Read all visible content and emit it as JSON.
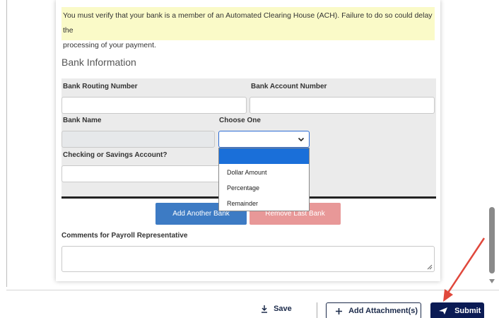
{
  "notice": {
    "line1": "You must verify that your bank is a member of an Automated Clearing House (ACH). Failure to do so could delay the",
    "line2": "processing of your payment."
  },
  "bank_section": {
    "title": "Bank Information",
    "routing_label": "Bank Routing Number",
    "account_label": "Bank Account Number",
    "bank_name_label": "Bank Name",
    "choose_label": "Choose One",
    "checking_label": "Checking or Savings Account?",
    "routing_value": "",
    "account_value": "",
    "bank_name_value": "",
    "checking_value": ""
  },
  "choose_select": {
    "selected": "",
    "options": [
      "",
      "Dollar Amount",
      "Percentage",
      "Remainder"
    ]
  },
  "buttons": {
    "add_bank": "Add Another Bank",
    "remove_bank": "Remove Last Bank"
  },
  "comments": {
    "label": "Comments for Payroll Representative",
    "value": ""
  },
  "footer": {
    "save": "Save",
    "attach": "Add Attachment(s)",
    "submit": "Submit"
  },
  "colors": {
    "accent_blue": "#3d7bc4",
    "remove_red": "#e89898",
    "submit_navy": "#0b1b54",
    "arrow_red": "#e0483c",
    "notice_yellow": "#fafac8"
  },
  "icons": [
    "save-icon",
    "plus-icon",
    "send-icon",
    "chevron-down-icon",
    "resize-grip-icon",
    "scroll-down-arrow-icon"
  ]
}
